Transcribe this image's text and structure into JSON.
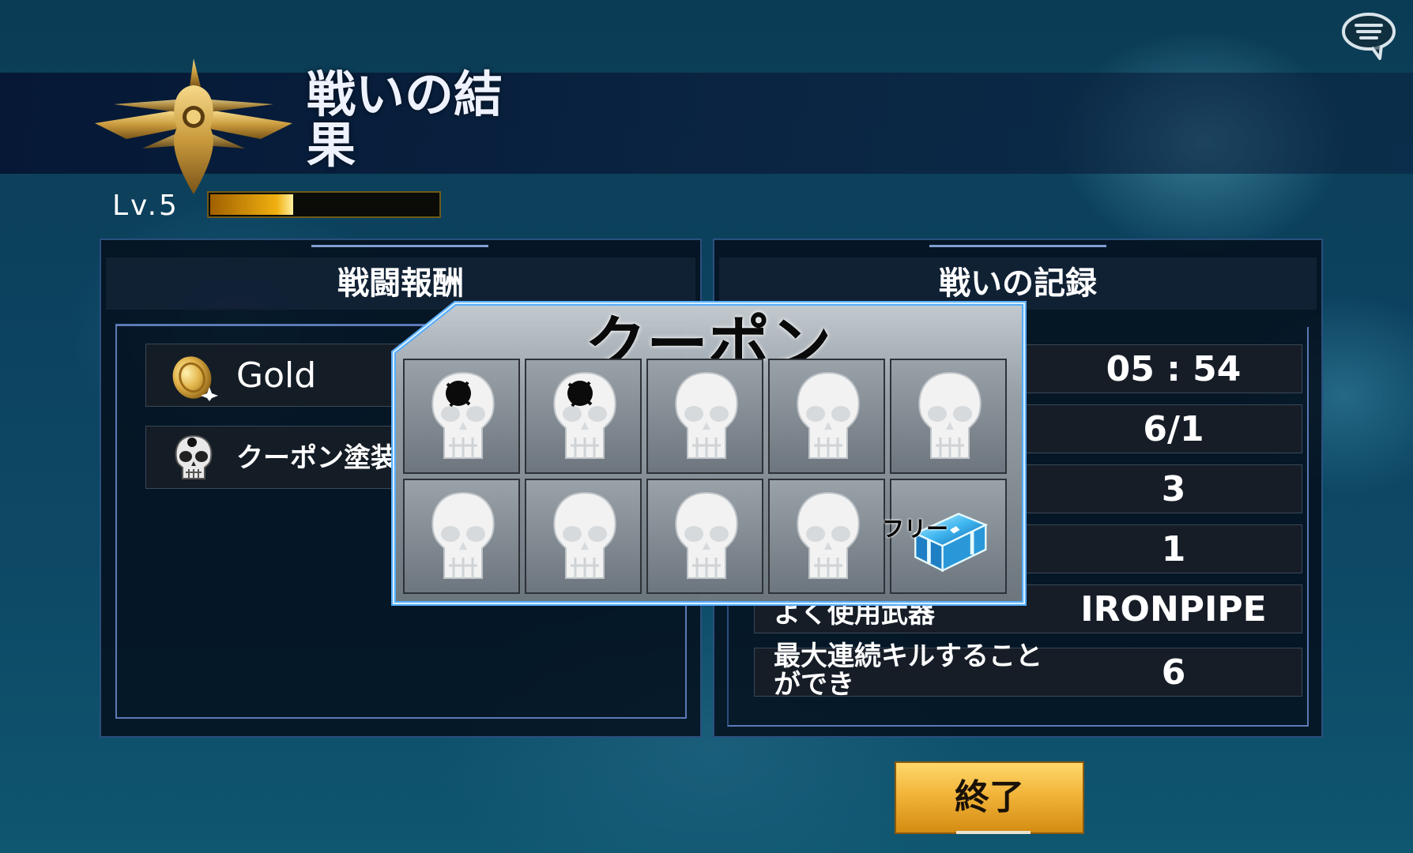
{
  "header": {
    "title": "戦いの結果",
    "level_label": "Lv.5",
    "xp_progress": 0.36
  },
  "rewards_panel": {
    "title": "戦闘報酬",
    "items": [
      {
        "icon": "gold-coin-icon",
        "label": "Gold"
      },
      {
        "icon": "skull-icon",
        "label": "クーポン塗装"
      }
    ]
  },
  "record_panel": {
    "title": "戦いの記録",
    "rows": [
      {
        "label": "",
        "value": "05 : 54"
      },
      {
        "label": "",
        "value": "6/1"
      },
      {
        "label": "",
        "value": "3"
      },
      {
        "label": "",
        "value": "1"
      },
      {
        "label": "よく使用武器",
        "value": "IRONPIPE"
      },
      {
        "label": "最大連続キルすることができ",
        "value": "6"
      }
    ]
  },
  "coupon_popup": {
    "title": "クーポン",
    "slots": [
      {
        "type": "skull",
        "state": "stamped"
      },
      {
        "type": "skull",
        "state": "stamped"
      },
      {
        "type": "skull",
        "state": "empty"
      },
      {
        "type": "skull",
        "state": "empty"
      },
      {
        "type": "skull",
        "state": "empty"
      },
      {
        "type": "skull",
        "state": "empty"
      },
      {
        "type": "skull",
        "state": "empty"
      },
      {
        "type": "skull",
        "state": "empty"
      },
      {
        "type": "skull",
        "state": "empty"
      },
      {
        "type": "chest",
        "label": "フリー"
      }
    ]
  },
  "end_button": {
    "label": "終了"
  },
  "icons": {
    "chat": "chat-bubble-icon",
    "emblem": "eagle-rank-emblem-icon"
  },
  "colors": {
    "accent_gold": "#f2b43a",
    "xp_fill": "#f0b010",
    "panel_border": "#5c79b8"
  }
}
